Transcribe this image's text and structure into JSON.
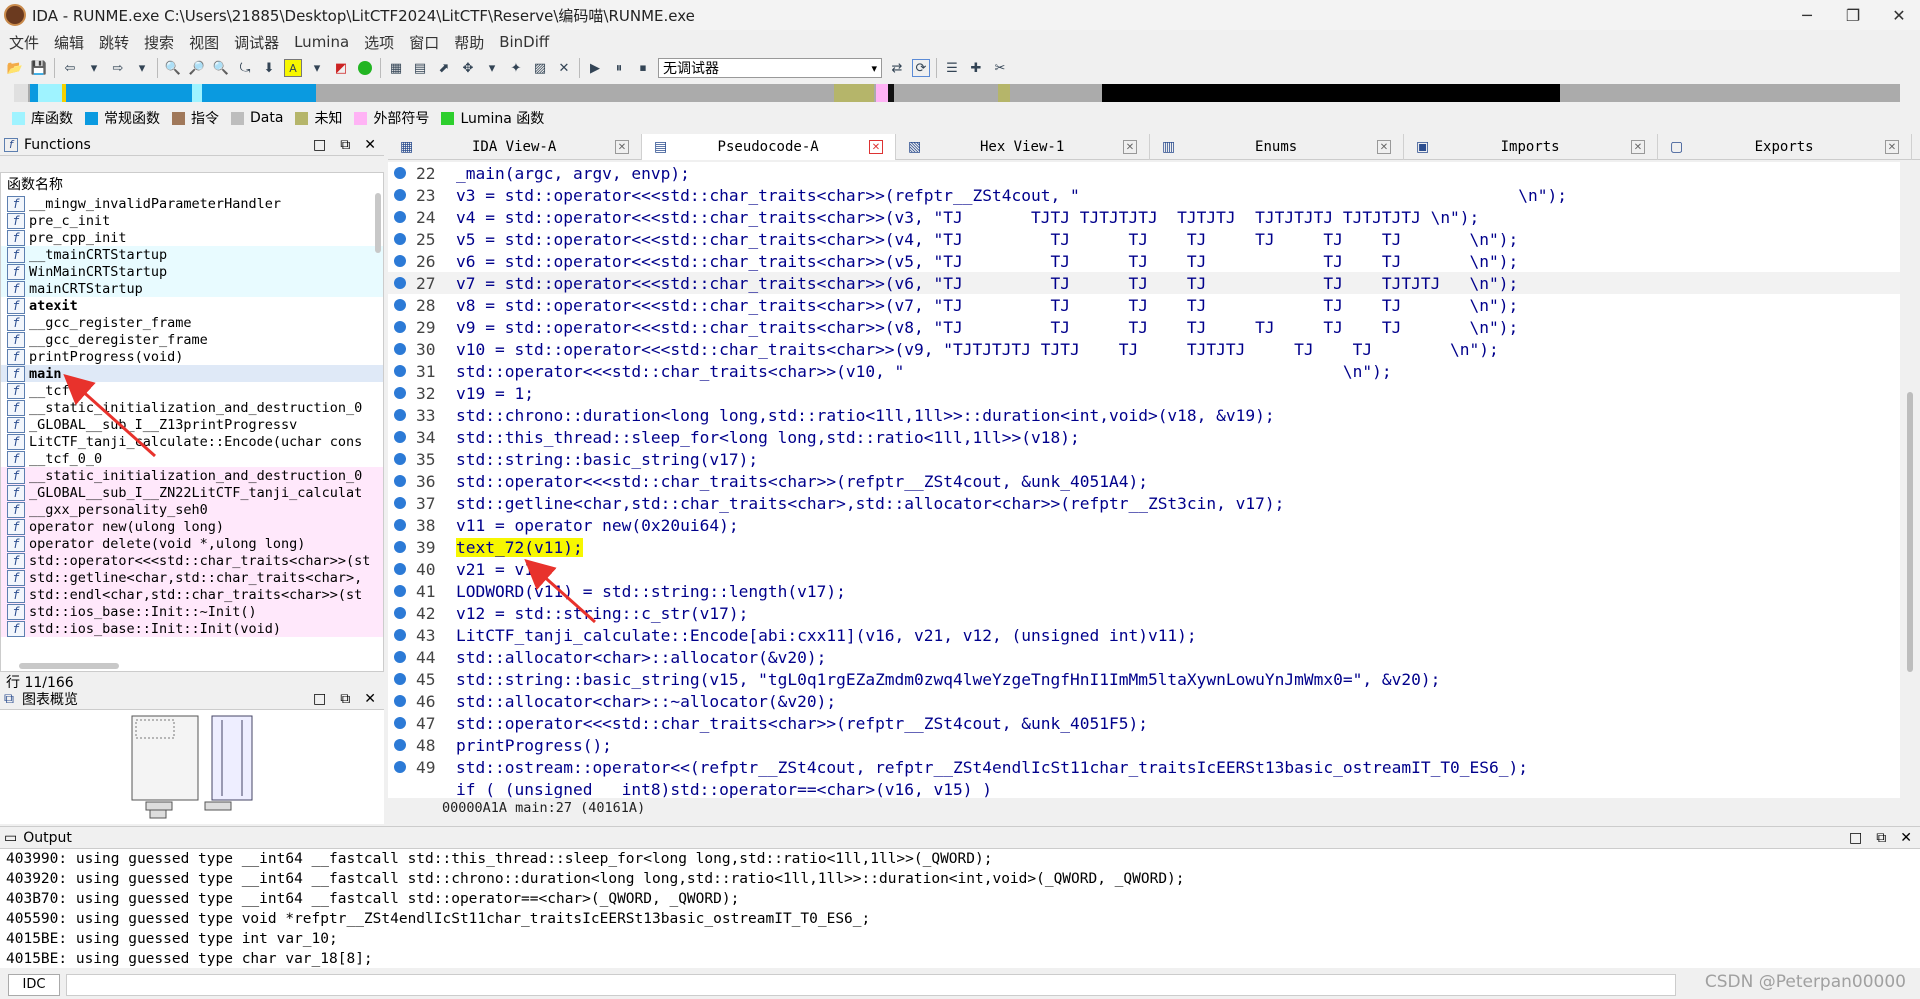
{
  "window": {
    "title": "IDA - RUNME.exe C:\\Users\\21885\\Desktop\\LitCTF2024\\LitCTF\\Reserve\\编码喵\\RUNME.exe",
    "minimize": "─",
    "maximize": "❐",
    "close": "✕"
  },
  "menu": [
    "文件",
    "编辑",
    "跳转",
    "搜索",
    "视图",
    "调试器",
    "Lumina",
    "选项",
    "窗口",
    "帮助",
    "BinDiff"
  ],
  "toolbar": {
    "debugger_select": "无调试器"
  },
  "legend": [
    {
      "label": "库函数",
      "color": "#9ff3ff"
    },
    {
      "label": "常规函数",
      "color": "#0a9ae0"
    },
    {
      "label": "指令",
      "color": "#a0785a"
    },
    {
      "label": "Data",
      "color": "#bdbdbd"
    },
    {
      "label": "未知",
      "color": "#b5b56a"
    },
    {
      "label": "外部符号",
      "color": "#ffb3f5"
    },
    {
      "label": "Lumina 函数",
      "color": "#2ecf2e"
    }
  ],
  "functions_panel": {
    "title": "Functions",
    "header": "函数名称",
    "status": "行 11/166",
    "items": [
      "__mingw_invalidParameterHandler",
      "pre_c_init",
      "pre_cpp_init",
      "__tmainCRTStartup",
      "WinMainCRTStartup",
      "mainCRTStartup",
      "atexit",
      "__gcc_register_frame",
      "__gcc_deregister_frame",
      "printProgress(void)",
      "main",
      "__tcf",
      "__static_initialization_and_destruction_0",
      "_GLOBAL__sub_I__Z13printProgressv",
      "LitCTF_tanji_calculate::Encode(uchar cons",
      "__tcf_0_0",
      "__static_initialization_and_destruction_0",
      "_GLOBAL__sub_I__ZN22LitCTF_tanji_calculat",
      "__gxx_personality_seh0",
      "operator new(ulong long)",
      "operator delete(void *,ulong long)",
      "std::operator<<<std::char_traits<char>>(st",
      "std::getline<char,std::char_traits<char>,",
      "std::endl<char,std::char_traits<char>>(st",
      "std::ios_base::Init::~Init()",
      "std::ios_base::Init::Init(void)"
    ]
  },
  "overview_panel": {
    "title": "图表概览"
  },
  "tabs": [
    {
      "label": "IDA View-A"
    },
    {
      "label": "Pseudocode-A"
    },
    {
      "label": "Hex View-1"
    },
    {
      "label": "Enums"
    },
    {
      "label": "Imports"
    },
    {
      "label": "Exports"
    }
  ],
  "code_lines": [
    {
      "n": "22",
      "text": "_main(argc, argv, envp);"
    },
    {
      "n": "23",
      "text": "v3 = std::operator<<<std::char_traits<char>>(refptr__ZSt4cout, \"                                             \\n\");"
    },
    {
      "n": "24",
      "text": "v4 = std::operator<<<std::char_traits<char>>(v3, \"TJ       TJTJ TJTJTJTJ  TJTJTJ  TJTJTJTJ TJTJTJTJ \\n\");"
    },
    {
      "n": "25",
      "text": "v5 = std::operator<<<std::char_traits<char>>(v4, \"TJ         TJ      TJ    TJ     TJ     TJ    TJ       \\n\");"
    },
    {
      "n": "26",
      "text": "v6 = std::operator<<<std::char_traits<char>>(v5, \"TJ         TJ      TJ    TJ            TJ    TJ       \\n\");"
    },
    {
      "n": "27",
      "text": "v7 = std::operator<<<std::char_traits<char>>(v6, \"TJ         TJ      TJ    TJ            TJ    TJTJTJ   \\n\");"
    },
    {
      "n": "28",
      "text": "v8 = std::operator<<<std::char_traits<char>>(v7, \"TJ         TJ      TJ    TJ            TJ    TJ       \\n\");"
    },
    {
      "n": "29",
      "text": "v9 = std::operator<<<std::char_traits<char>>(v8, \"TJ         TJ      TJ    TJ     TJ     TJ    TJ       \\n\");"
    },
    {
      "n": "30",
      "text": "v10 = std::operator<<<std::char_traits<char>>(v9, \"TJTJTJTJ TJTJ    TJ     TJTJTJ     TJ    TJ        \\n\");"
    },
    {
      "n": "31",
      "text": "std::operator<<<std::char_traits<char>>(v10, \"                                             \\n\");"
    },
    {
      "n": "32",
      "text": "v19 = 1;"
    },
    {
      "n": "33",
      "text": "std::chrono::duration<long long,std::ratio<1ll,1ll>>::duration<int,void>(v18, &v19);"
    },
    {
      "n": "34",
      "text": "std::this_thread::sleep_for<long long,std::ratio<1ll,1ll>>(v18);"
    },
    {
      "n": "35",
      "text": "std::string::basic_string(v17);"
    },
    {
      "n": "36",
      "text": "std::operator<<<std::char_traits<char>>(refptr__ZSt4cout, &unk_4051A4);"
    },
    {
      "n": "37",
      "text": "std::getline<char,std::char_traits<char>,std::allocator<char>>(refptr__ZSt3cin, v17);"
    },
    {
      "n": "38",
      "text": "v11 = operator new(0x20ui64);"
    },
    {
      "n": "39",
      "text": "text_72(v11);"
    },
    {
      "n": "40",
      "text": "v21 = v11;"
    },
    {
      "n": "41",
      "text": "LODWORD(v11) = std::string::length(v17);"
    },
    {
      "n": "42",
      "text": "v12 = std::string::c_str(v17);"
    },
    {
      "n": "43",
      "text": "LitCTF_tanji_calculate::Encode[abi:cxx11](v16, v21, v12, (unsigned int)v11);"
    },
    {
      "n": "44",
      "text": "std::allocator<char>::allocator(&v20);"
    },
    {
      "n": "45",
      "text": "std::string::basic_string(v15, \"tgL0q1rgEZaZmdm0zwq4lweYzgeTngfHnI1ImMm5ltaXywnLowuYnJmWmx0=\", &v20);"
    },
    {
      "n": "46",
      "text": "std::allocator<char>::~allocator(&v20);"
    },
    {
      "n": "47",
      "text": "std::operator<<<std::char_traits<char>>(refptr__ZSt4cout, &unk_4051F5);"
    },
    {
      "n": "48",
      "text": "printProgress();"
    },
    {
      "n": "49",
      "text": "std::ostream::operator<<(refptr__ZSt4cout, refptr__ZSt4endlIcSt11char_traitsIcEERSt13basic_ostreamIT_T0_ES6_);"
    },
    {
      "n": "",
      "text": "if ( (unsigned   int8)std::operator==<char>(v16, v15) )"
    }
  ],
  "code_status": "00000A1A main:27 (40161A)",
  "output": {
    "title": "Output",
    "lines": [
      "403990: using guessed type __int64 __fastcall std::this_thread::sleep_for<long long,std::ratio<1ll,1ll>>(_QWORD);",
      "403920: using guessed type __int64 __fastcall std::chrono::duration<long long,std::ratio<1ll,1ll>>::duration<int,void>(_QWORD, _QWORD);",
      "403B70: using guessed type __int64 __fastcall std::operator==<char>(_QWORD, _QWORD);",
      "405590: using guessed type void *refptr__ZSt4endlIcSt11char_traitsIcEERSt13basic_ostreamIT_T0_ES6_;",
      "4015BE: using guessed type int var_10;",
      "4015BE: using guessed type char var_18[8];"
    ]
  },
  "cmd": {
    "button": "IDC"
  },
  "watermark": "CSDN @Peterpan00000"
}
